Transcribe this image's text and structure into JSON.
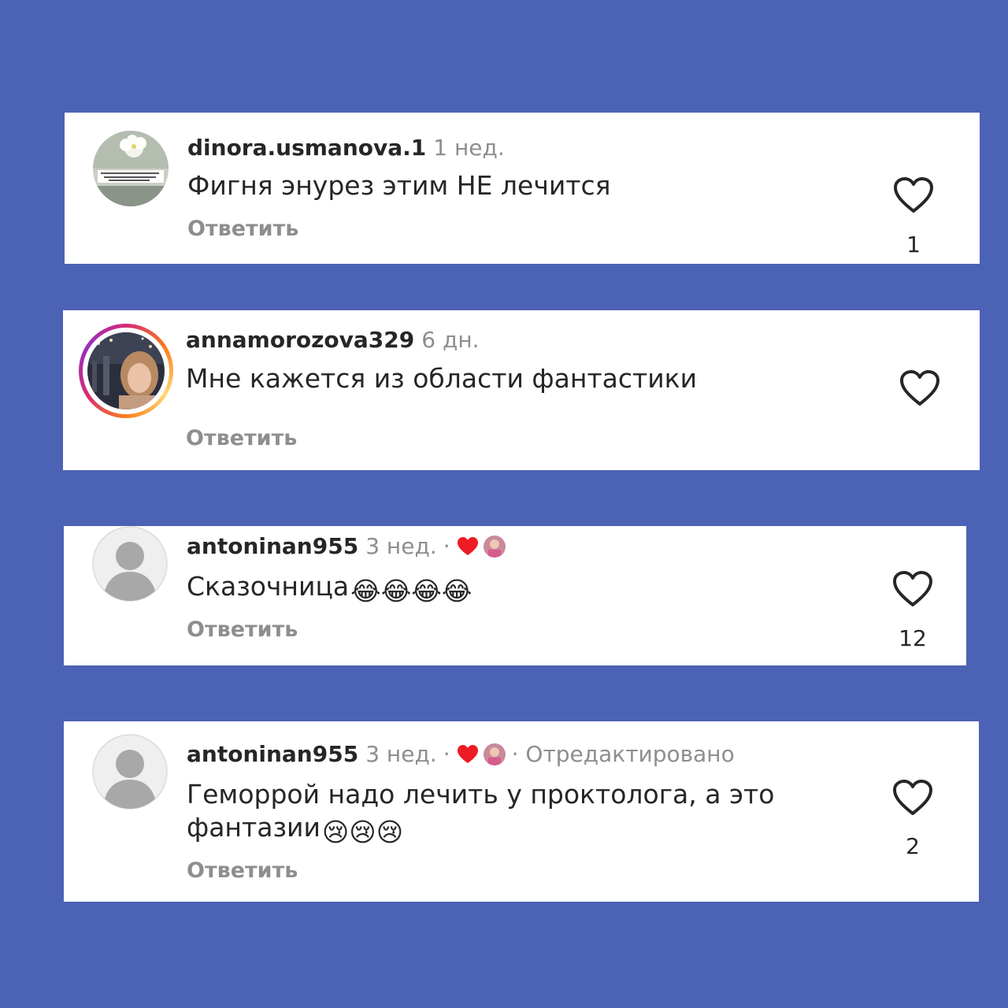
{
  "colors": {
    "background": "#4c62b4",
    "card": "#ffffff",
    "text": "#262626",
    "muted": "#8e8e8e",
    "heart": "#ed1c24"
  },
  "comments": [
    {
      "username": "dinora.usmanova.1",
      "time": "1 нед.",
      "text": "Фигня энурез этим НЕ лечится",
      "reply": "Ответить",
      "likes": "1",
      "avatar": "flower-photo"
    },
    {
      "username": "annamorozova329",
      "time": "6 дн.",
      "text": "Мне кажется из области фантастики",
      "reply": "Ответить",
      "avatar": "photo-with-story-ring"
    },
    {
      "username": "antoninan955",
      "time": "3 нед.",
      "separator": "·",
      "text": "Сказочница",
      "emoji": "😂😂😂😂",
      "reply": "Ответить",
      "likes": "12",
      "avatar": "default-avatar"
    },
    {
      "username": "antoninan955",
      "time": "3 нед.",
      "separator": "·",
      "edited": "· Отредактировано",
      "text_line1": "Геморрой надо лечить у проктолога, а это",
      "text_line2": "фантазии",
      "emoji": "😢😢😢",
      "reply": "Ответить",
      "likes": "2",
      "avatar": "default-avatar"
    }
  ]
}
